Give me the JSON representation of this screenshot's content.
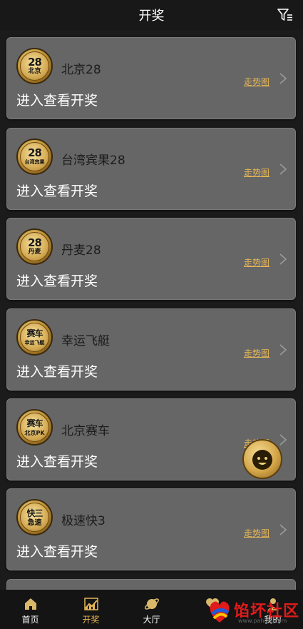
{
  "header": {
    "title": "开奖"
  },
  "games": [
    {
      "name": "北京28",
      "logo_top": "28",
      "logo_bottom": "北京",
      "enter": "进入查看开奖",
      "trend": "走势图"
    },
    {
      "name": "台湾宾果28",
      "logo_top": "28",
      "logo_bottom": "台湾宾果",
      "enter": "进入查看开奖",
      "trend": "走势图"
    },
    {
      "name": "丹麦28",
      "logo_top": "28",
      "logo_bottom": "丹麦",
      "enter": "进入查看开奖",
      "trend": "走势图"
    },
    {
      "name": "幸运飞艇",
      "logo_top": "赛车",
      "logo_bottom": "幸运飞艇",
      "enter": "进入查看开奖",
      "trend": "走势图"
    },
    {
      "name": "北京赛车",
      "logo_top": "赛车",
      "logo_bottom": "北京PK",
      "enter": "进入查看开奖",
      "trend": "走势图"
    },
    {
      "name": "极速快3",
      "logo_top": "快三",
      "logo_bottom": "急速",
      "enter": "进入查看开奖",
      "trend": "走势图"
    }
  ],
  "tabs": [
    {
      "label": "首页",
      "icon": "home-icon",
      "active": false
    },
    {
      "label": "开奖",
      "icon": "chart-icon",
      "active": true
    },
    {
      "label": "大厅",
      "icon": "planet-icon",
      "active": false
    },
    {
      "label": "",
      "icon": "heart-icon",
      "active": false
    },
    {
      "label": "我的",
      "icon": "user-icon",
      "active": false
    }
  ],
  "accent_color": "#e6b655",
  "watermark": {
    "text": "馅坏社区",
    "sub": "www.pahoui.com"
  }
}
